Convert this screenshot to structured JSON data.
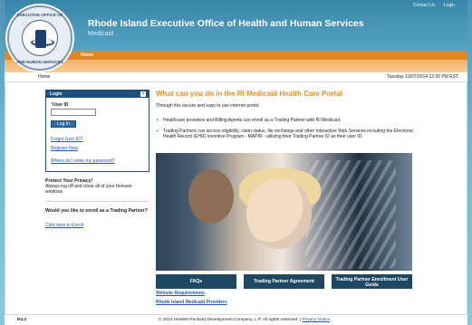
{
  "header": {
    "title": "Rhode Island Executive Office of Health and Human Services",
    "subtitle": "Medicaid",
    "toplinks": [
      "Contact Us",
      "Login"
    ]
  },
  "nav": {
    "primary": "Home"
  },
  "breadcrumb": {
    "home": "Home",
    "datetime": "Tuesday 10/07/2014 12:35 PM EST"
  },
  "login": {
    "header": "Login",
    "help": "?",
    "user_id_label": "User ID",
    "required_mark": "*",
    "login_button": "Log In",
    "forgot_user_id": "Forgot User ID?",
    "register_now": "Register Now",
    "where_do": "Where do I enter my password?"
  },
  "privacy": {
    "title": "Protect Your Privacy!",
    "text": "Always log off and close all of your browser windows"
  },
  "enroll": {
    "title": "Would you like to enroll as a Trading Partner?",
    "link": "Click here to Enroll"
  },
  "main": {
    "heading": "What can you do in the RI Medicaid Health Care Portal",
    "intro": "Through this secure and easy to use internet portal:",
    "bullets": [
      "Healthcare providers and Billing Agents can enroll as a Trading Partner with RI Medicaid.",
      "Trading Partners can access eligibility, claim status, file exchange and other Interactive Web Services including the Electronic Health Record (EHR) Incentive Program - MAPIR - utilizing their Trading Partner ID as their user ID."
    ]
  },
  "buttons": {
    "faqs": "FAQs",
    "agreement": "Trading Partner Agreement",
    "guide": "Trading Partner Enrollment User Guide"
  },
  "links": {
    "website_requirements": "Website Requirements",
    "ri_medicaid_providers": "Rhode Island Medicaid Providers"
  },
  "footer": {
    "version": "R4.2",
    "copyright": "© 2014 Hewlett-Packard Development Company, L.P. All rights reserved. |",
    "privacy_notice": "Privacy Notice"
  },
  "seal": {
    "top": "EXECUTIVE OFFICE OF",
    "bottom": "AND HUMAN SERVICES"
  }
}
